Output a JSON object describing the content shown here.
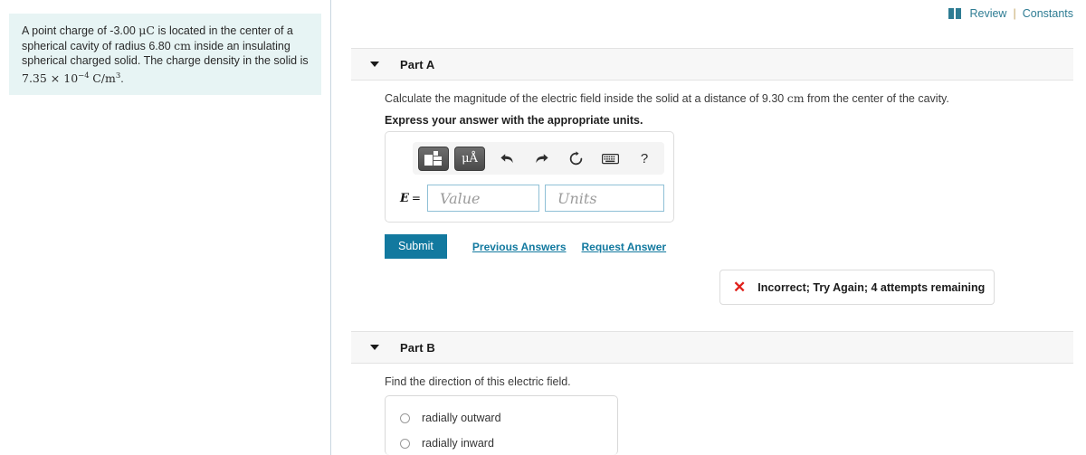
{
  "problem": {
    "line1_a": "A point charge of -3.00 ",
    "line1_mu": "μC",
    "line1_b": " is located in the center of a",
    "line2_a": "spherical cavity of radius 6.80 ",
    "line2_unit": "cm",
    "line2_b": " inside an insulating",
    "line3": "spherical charged solid. The charge density in the solid is",
    "line4_a": "7.35 × 10",
    "line4_exp": "−4",
    "line4_unit": "C/m",
    "line4_unit_exp": "3",
    "line4_end": "."
  },
  "topbar": {
    "book_icon": "book-icon",
    "review_label": "Review",
    "separator": "|",
    "constants_label": "Constants"
  },
  "partA": {
    "caret_icon": "chevron-down-icon",
    "title": "Part A",
    "question_a": "Calculate the magnitude of the electric field inside the solid at a distance of 9.30 ",
    "question_unit": "cm",
    "question_b": " from the center of the cavity.",
    "instruction": "Express your answer with the appropriate units.",
    "toolbar": {
      "template_icon": "math-template-icon",
      "units_label": "μÅ",
      "undo_icon": "undo-arrow-icon",
      "redo_icon": "redo-arrow-icon",
      "reset_icon": "reset-circular-arrow-icon",
      "keyboard_icon": "keyboard-icon",
      "help_label": "?"
    },
    "equation_label": "E",
    "equation_equals": "=",
    "value_placeholder": "Value",
    "units_placeholder": "Units",
    "value_current": "",
    "units_current": "",
    "submit_label": "Submit",
    "previous_answers_label": "Previous Answers",
    "request_answer_label": "Request Answer",
    "feedback": {
      "icon": "x-mark-icon",
      "text": "Incorrect; Try Again; 4 attempts remaining"
    }
  },
  "partB": {
    "caret_icon": "chevron-down-icon",
    "title": "Part B",
    "question": "Find the direction of this electric field.",
    "choices": [
      {
        "label": "radially outward",
        "selected": false
      },
      {
        "label": "radially inward",
        "selected": false
      }
    ]
  },
  "colors": {
    "accent_teal": "#12799f",
    "panel_bg": "#e7f4f4",
    "link": "#2e7c93",
    "error_red": "#e0201b",
    "field_border": "#8fc0d6",
    "header_bg": "#f7f7f7"
  }
}
